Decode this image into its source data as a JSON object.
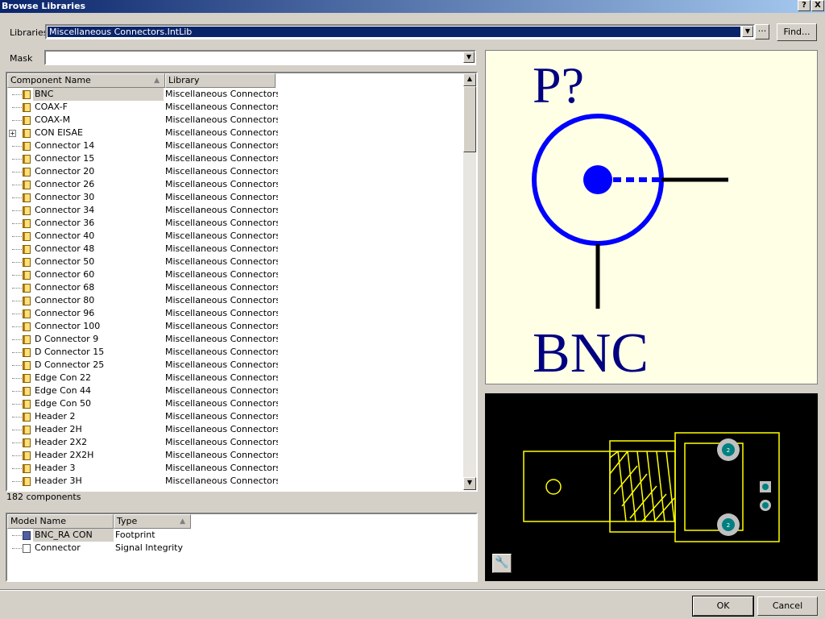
{
  "window": {
    "title": "Browse Libraries",
    "help": "?",
    "close": "X"
  },
  "libraries": {
    "label": "Libraries",
    "value": "Miscellaneous Connectors.IntLib",
    "more": "···",
    "find": "Find..."
  },
  "mask": {
    "label": "Mask",
    "value": ""
  },
  "components": {
    "columns": [
      "Component Name",
      "Library"
    ],
    "rows": [
      [
        "BNC",
        "Miscellaneous Connectors.Ir"
      ],
      [
        "COAX-F",
        "Miscellaneous Connectors.Ir"
      ],
      [
        "COAX-M",
        "Miscellaneous Connectors.Ir"
      ],
      [
        "CON EISAE",
        "Miscellaneous Connectors.Ir"
      ],
      [
        "Connector 14",
        "Miscellaneous Connectors.Ir"
      ],
      [
        "Connector 15",
        "Miscellaneous Connectors.Ir"
      ],
      [
        "Connector 20",
        "Miscellaneous Connectors.Ir"
      ],
      [
        "Connector 26",
        "Miscellaneous Connectors.Ir"
      ],
      [
        "Connector 30",
        "Miscellaneous Connectors.Ir"
      ],
      [
        "Connector 34",
        "Miscellaneous Connectors.Ir"
      ],
      [
        "Connector 36",
        "Miscellaneous Connectors.Ir"
      ],
      [
        "Connector 40",
        "Miscellaneous Connectors.Ir"
      ],
      [
        "Connector 48",
        "Miscellaneous Connectors.Ir"
      ],
      [
        "Connector 50",
        "Miscellaneous Connectors.Ir"
      ],
      [
        "Connector 60",
        "Miscellaneous Connectors.Ir"
      ],
      [
        "Connector 68",
        "Miscellaneous Connectors.Ir"
      ],
      [
        "Connector 80",
        "Miscellaneous Connectors.Ir"
      ],
      [
        "Connector 96",
        "Miscellaneous Connectors.Ir"
      ],
      [
        "Connector 100",
        "Miscellaneous Connectors.Ir"
      ],
      [
        "D Connector 9",
        "Miscellaneous Connectors.Ir"
      ],
      [
        "D Connector 15",
        "Miscellaneous Connectors.Ir"
      ],
      [
        "D Connector 25",
        "Miscellaneous Connectors.Ir"
      ],
      [
        "Edge Con 22",
        "Miscellaneous Connectors.Ir"
      ],
      [
        "Edge Con 44",
        "Miscellaneous Connectors.Ir"
      ],
      [
        "Edge Con 50",
        "Miscellaneous Connectors.Ir"
      ],
      [
        "Header 2",
        "Miscellaneous Connectors.Ir"
      ],
      [
        "Header 2H",
        "Miscellaneous Connectors.Ir"
      ],
      [
        "Header 2X2",
        "Miscellaneous Connectors.Ir"
      ],
      [
        "Header 2X2H",
        "Miscellaneous Connectors.Ir"
      ],
      [
        "Header 3",
        "Miscellaneous Connectors.Ir"
      ],
      [
        "Header 3H",
        "Miscellaneous Connectors.Ir"
      ]
    ],
    "selected": "BNC",
    "expandable": "CON EISAE",
    "count": "182 components"
  },
  "models": {
    "columns": [
      "Model Name",
      "Type"
    ],
    "rows": [
      [
        "BNC_RA CON",
        "Footprint"
      ],
      [
        "Connector",
        "Signal Integrity"
      ]
    ]
  },
  "preview": {
    "designator": "P?",
    "comment": "BNC",
    "colors": {
      "background": "#ffffe6",
      "body": "#0000ff",
      "text": "#000080",
      "pin": "#000000"
    }
  },
  "footprint": {
    "colors": {
      "background": "#000000",
      "outline": "#ffff00",
      "pad": "#c0c0c0",
      "hole": "#008080"
    },
    "pad_label": "2"
  },
  "buttons": {
    "ok": "OK",
    "cancel": "Cancel"
  }
}
